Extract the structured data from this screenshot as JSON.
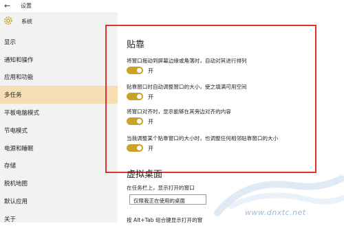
{
  "window": {
    "title": "设置",
    "back_icon": "back-arrow-icon"
  },
  "sidebar": {
    "app_title": "系统",
    "items": [
      {
        "label": "显示"
      },
      {
        "label": "通知和操作"
      },
      {
        "label": "应用和功能"
      },
      {
        "label": "多任务",
        "active": true
      },
      {
        "label": "平板电脑模式"
      },
      {
        "label": "节电模式"
      },
      {
        "label": "电源和睡眠"
      },
      {
        "label": "存储"
      },
      {
        "label": "脱机地图"
      },
      {
        "label": "默认应用"
      },
      {
        "label": "关于"
      }
    ]
  },
  "snap": {
    "title": "贴靠",
    "options": [
      {
        "text": "将窗口拖动到屏幕边缘或角落时，自动对其进行排列",
        "state": "开",
        "on": true
      },
      {
        "text": "贴靠窗口时自动调整窗口的大小，使之填满可用空间",
        "state": "开",
        "on": true
      },
      {
        "text": "将窗口对齐时，显示能够在其旁边对齐的内容",
        "state": "开",
        "on": true
      },
      {
        "text": "当我调整某个贴靠窗口的大小时，也调整任何相邻贴靠窗口的大小",
        "state": "开",
        "on": true
      }
    ]
  },
  "virtual_desktops": {
    "title": "虚拟桌面",
    "taskbar_label": "在任务栏上，显示打开的窗口",
    "taskbar_value": "仅限我正在使用的桌面",
    "alt_tab_label": "按 Alt+Tab 组合键显示打开的窗"
  },
  "colors": {
    "accent": "#c9a227",
    "highlight": "#e03030",
    "active_nav": "#f5deb3"
  },
  "watermark": {
    "text": "www.dnxtc.net"
  }
}
